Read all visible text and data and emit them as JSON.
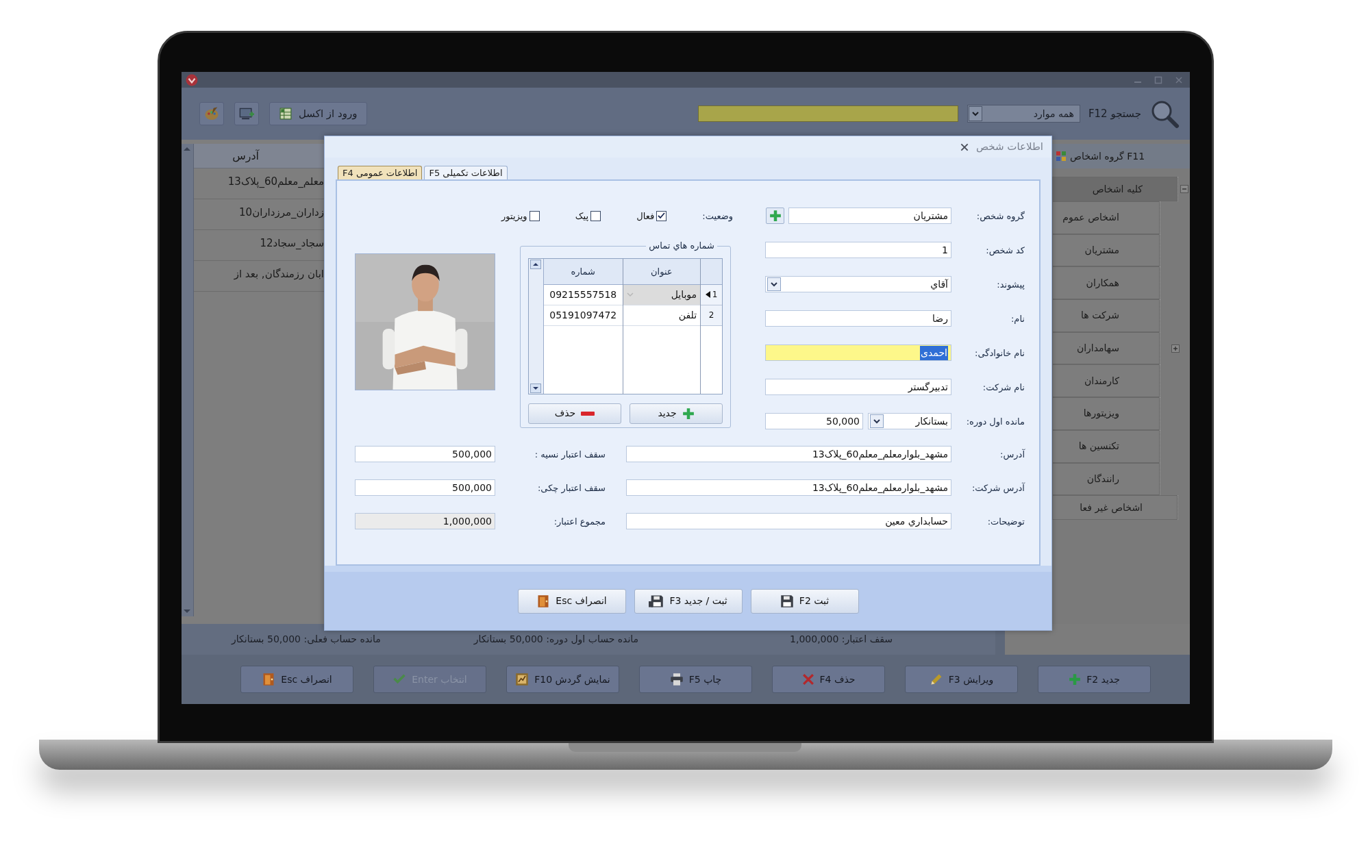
{
  "app": {
    "toolbar": {
      "import_button": "ورود از اکسل",
      "search_label": "جستجو F12",
      "search_scope": "همه موارد"
    },
    "table": {
      "columns": [
        "آدرس"
      ],
      "rows": [
        [
          "معلم_معلم60_پلاک13"
        ],
        [
          "زداران_مرزداران10"
        ],
        [
          "سجاد_سجاد12"
        ],
        [
          "ابان رزمندگان, بعد از"
        ]
      ]
    },
    "sidebar": {
      "title": "گروه اشخاص F11",
      "tree": [
        {
          "label": "کلیه اشخاص",
          "selected": true,
          "expanded": true,
          "children": [
            {
              "label": "اشخاص عموم",
              "selected": false
            },
            {
              "label": "مشتریان",
              "selected": false
            },
            {
              "label": "همکاران",
              "selected": false
            },
            {
              "label": "شرکت ها",
              "selected": false
            },
            {
              "label": "سهامداران",
              "selected": false,
              "expanded": false
            },
            {
              "label": "کارمندان",
              "selected": false
            },
            {
              "label": "ویزیتورها",
              "selected": false
            },
            {
              "label": "تکنسین ها",
              "selected": false
            },
            {
              "label": "رانندگان",
              "selected": false
            }
          ]
        },
        {
          "label": "اشخاص غیر فعا",
          "selected": false
        }
      ]
    },
    "status_bar": [
      "سقف اعتبار: 1,000,000",
      "مانده حساب اول دوره: 50,000 بستانکار",
      "مانده حساب فعلی: 50,000 بستانکار"
    ],
    "buttons": [
      {
        "label": "جدید F2",
        "disabled": false
      },
      {
        "label": "ویرایش F3",
        "disabled": false
      },
      {
        "label": "حذف F4",
        "disabled": false
      },
      {
        "label": "چاپ F5",
        "disabled": false
      },
      {
        "label": "نمایش گردش F10",
        "disabled": false
      },
      {
        "label": "انتخاب Enter",
        "disabled": true
      },
      {
        "label": "انصراف Esc",
        "disabled": false
      }
    ]
  },
  "dialog": {
    "title": "اطلاعات شخص",
    "tabs": [
      {
        "label": "اطلاعات تکمیلی F5",
        "selected": false
      },
      {
        "label": "اطلاعات عمومی F4",
        "selected": true
      }
    ],
    "fields": [
      {
        "kind": "add",
        "label": "گروه شخص:",
        "value": "مشتریان",
        "focused": false
      },
      {
        "kind": "text",
        "label": "کد شخص:",
        "value": "1",
        "focused": false
      },
      {
        "kind": "select",
        "label": "پیشوند:",
        "value": "آقاي",
        "focused": false
      },
      {
        "kind": "text",
        "label": "نام:",
        "value": "رضا",
        "focused": false
      },
      {
        "kind": "text",
        "label": "نام خانوادگی:",
        "value": "احمدی",
        "focused": true
      },
      {
        "kind": "text",
        "label": "نام شرکت:",
        "value": "تدبیرگستر",
        "focused": false
      },
      {
        "kind": "amount",
        "label": "مانده اول دوره:",
        "value": "50,000",
        "option": "بستانکار",
        "focused": false
      }
    ],
    "status": {
      "label": "وضعیت:",
      "options": [
        {
          "label": "فعال",
          "checked": true
        },
        {
          "label": "پیک",
          "checked": false
        },
        {
          "label": "ویزیتور",
          "checked": false
        }
      ]
    },
    "contacts": {
      "title": "شماره هاي تماس",
      "columns": [
        "عنوان",
        "شماره"
      ],
      "rows": [
        {
          "index": "1",
          "title": "موبایل",
          "number": "09215557518",
          "selected": true
        },
        {
          "index": "2",
          "title": "تلفن",
          "number": "05191097472",
          "selected": false
        }
      ],
      "buttons": [
        "جدید",
        "حذف"
      ]
    },
    "details": [
      {
        "label": "آدرس:",
        "value": "مشهد_بلوارمعلم_معلم60_پلاک13"
      },
      {
        "label": "آدرس شرکت:",
        "value": "مشهد_بلوارمعلم_معلم60_پلاک13"
      },
      {
        "label": "توضیحات:",
        "value": "حسابداري معين"
      }
    ],
    "credit": [
      {
        "label": "سقف اعتبار نسیه :",
        "value": "500,000",
        "readonly": false
      },
      {
        "label": "سقف اعتبار چکی:",
        "value": "500,000",
        "readonly": false
      },
      {
        "label": "مجموع اعتبار:",
        "value": "1,000,000",
        "readonly": true
      }
    ],
    "actions": [
      "ثبت F2",
      "ثبت / جدید F3",
      "انصراف Esc"
    ]
  }
}
